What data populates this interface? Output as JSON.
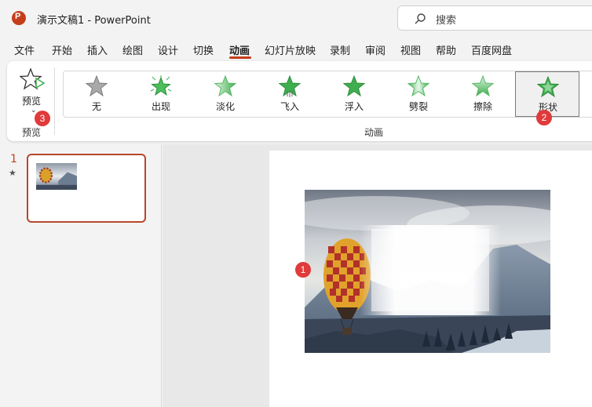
{
  "app": {
    "logo_letter": "P",
    "doc_title": "演示文稿1  -  PowerPoint"
  },
  "search": {
    "placeholder": "搜索"
  },
  "tabs": [
    {
      "label": "文件"
    },
    {
      "label": "开始"
    },
    {
      "label": "插入"
    },
    {
      "label": "绘图"
    },
    {
      "label": "设计"
    },
    {
      "label": "切换"
    },
    {
      "label": "动画"
    },
    {
      "label": "幻灯片放映"
    },
    {
      "label": "录制"
    },
    {
      "label": "审阅"
    },
    {
      "label": "视图"
    },
    {
      "label": "帮助"
    },
    {
      "label": "百度网盘"
    }
  ],
  "active_tab": "动画",
  "ribbon": {
    "preview": {
      "button_label": "预览",
      "group_label": "预览"
    },
    "animations": {
      "group_label": "动画",
      "items": [
        {
          "label": "无"
        },
        {
          "label": "出现"
        },
        {
          "label": "淡化"
        },
        {
          "label": "飞入"
        },
        {
          "label": "浮入"
        },
        {
          "label": "劈裂"
        },
        {
          "label": "擦除"
        },
        {
          "label": "形状"
        }
      ],
      "selected": "形状"
    }
  },
  "badges": {
    "one": "1",
    "two": "2",
    "three": "3"
  },
  "slides_panel": {
    "slide_number": "1",
    "slide_marker": "★"
  },
  "colors": {
    "accent": "#c43e1c",
    "badge": "#e03a3a",
    "star_green": "#3fae4f"
  }
}
